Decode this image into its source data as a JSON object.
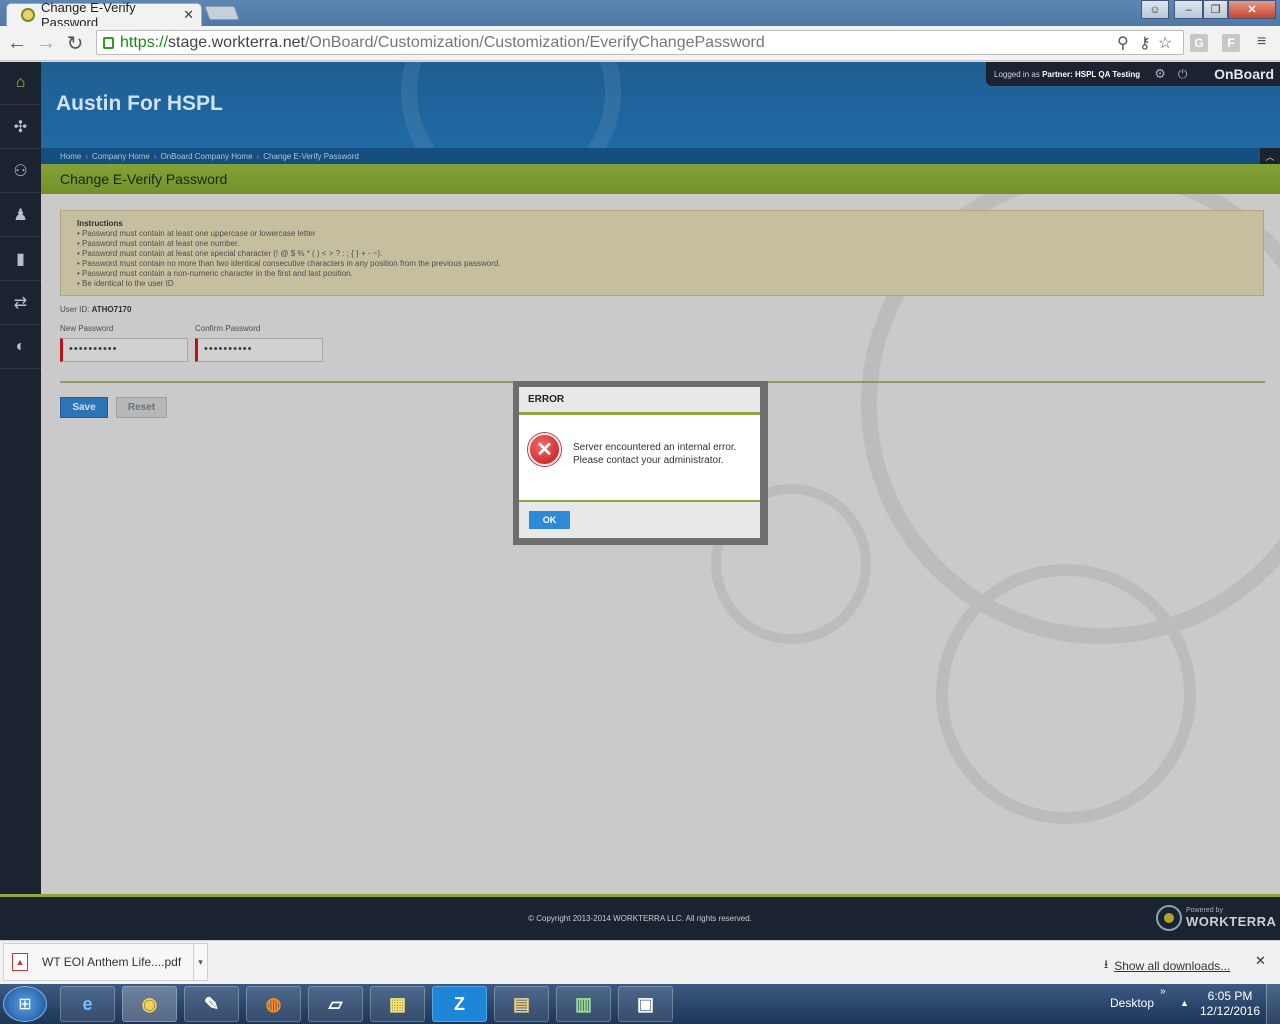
{
  "browser": {
    "tab_title": "Change E-Verify Password",
    "tab_close": "✕",
    "url_scheme": "https://",
    "url_host": "stage.workterra.net",
    "url_path": "/OnBoard/Customization/Customization/EverifyChangePassword",
    "window_buttons": [
      "‒",
      "❐",
      "✕"
    ],
    "nav": {
      "back": "←",
      "forward": "→",
      "reload": "↻"
    },
    "extensions": [
      "G",
      "F"
    ]
  },
  "rail": {
    "items": [
      "home-icon",
      "puzzle-icon",
      "user-network-icon",
      "user-icon",
      "chart-icon",
      "transfer-icon",
      "chat-icon"
    ]
  },
  "header": {
    "company": "Austin For HSPL",
    "logged_in_prefix": "Logged in as",
    "partner_label": "Partner:",
    "partner_name": "HSPL QA Testing",
    "module": "OnBoard"
  },
  "breadcrumb": [
    "Home",
    "Company Home",
    "OnBoard Company Home",
    "Change E-Verify Password"
  ],
  "page": {
    "title": "Change E-Verify Password"
  },
  "instructions": {
    "heading": "Instructions",
    "items": [
      "Password must contain at least one uppercase or lowercase letter",
      "Password must contain at least one number.",
      "Password must contain at least one special character (! @ $ % * ( ) < > ? : ; { } + - ~).",
      "Password must contain no more than two identical consecutive characters in any position from the previous password.",
      "Password must contain a non-numeric character in the first and last position.",
      "Be identical to the user ID"
    ]
  },
  "form": {
    "user_id_label": "User ID:",
    "user_id_value": "ATHO7170",
    "new_password_label": "New Password",
    "new_password_value": "••••••••••",
    "confirm_password_label": "Confirm Password",
    "confirm_password_value": "••••••••••",
    "save_label": "Save",
    "reset_label": "Reset"
  },
  "dialog": {
    "title": "ERROR",
    "message": "Server encountered an internal error. Please contact your administrator.",
    "ok_label": "OK",
    "icon": "error-x-icon"
  },
  "footer": {
    "copyright": "© Copyright 2013-2014 WORKTERRA LLC. All rights reserved.",
    "powered_by": "Powered by",
    "brand": "WORKTERRA"
  },
  "downloads": {
    "file_name": "WT EOI Anthem Life....pdf",
    "show_all": "Show all downloads...",
    "close": "✕"
  },
  "taskbar": {
    "start": "⊞",
    "apps": [
      "e",
      "◉",
      "✎",
      "◍",
      "▱",
      "▦",
      "Z",
      "▤",
      "▥",
      "▣"
    ],
    "desktop_label": "Desktop",
    "time": "6:05 PM",
    "date": "12/12/2016"
  }
}
